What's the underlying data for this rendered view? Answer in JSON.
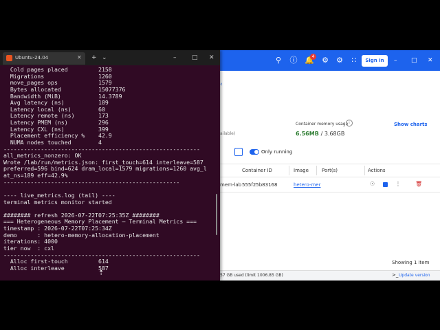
{
  "docker": {
    "sign_in": "Sign in",
    "notification_count": "4",
    "container_memory_usage_label": "Container memory usage",
    "memory_used": "6.56MB",
    "memory_total": "/ 3.68GB",
    "show_charts": "Show charts",
    "available_fragment": "ailable)",
    "only_running_label": "Only running",
    "table": {
      "headers": [
        "Container ID",
        "Image",
        "Port(s)",
        "Actions"
      ],
      "row": {
        "name_fragment": "mem-lab",
        "container_id": "555f25b83168",
        "image": "hetero-mer"
      }
    },
    "showing": "Showing 1 item",
    "footer_used": "57 GB used (limit 1006.85 GB)",
    "update_version": "Update version",
    "colors": {
      "accent": "#1d63ed",
      "memory_value": "#2e7d32"
    },
    "icons": [
      "search-icon",
      "help-icon",
      "bell-icon",
      "extensions-icon",
      "settings-icon",
      "apps-grid-icon",
      "minimize-icon",
      "maximize-icon",
      "close-icon"
    ]
  },
  "terminal": {
    "tab_title": "Ubuntu-24.04",
    "lines": [
      "  Cold pages placed         2158",
      "  Migrations                1260",
      "  move_pages ops            1579",
      "  Bytes allocated           15077376",
      "  Bandwidth (MiB)           14.3789",
      "  Avg latency (ns)          189",
      "  Latency local (ns)        60",
      "  Latency remote (ns)       173",
      "  Latency PMEM (ns)         296",
      "  Latency CXL (ns)          399",
      "  Placement efficiency %    42.9",
      "  NUMA nodes touched        4",
      "----------------------------------------------------------",
      "all_metrics_nonzero: OK",
      "Wrote /lab/run/metrics.json: first_touch=614 interleave=587",
      "preferred=596 bind=624 dram_local=1579 migrations=1260 avg_l",
      "at_ns=189 eff=42.9%",
      "----------------------------------------------------",
      "",
      "---- live_metrics.log (tail) ----",
      "terminal metrics monitor started",
      "",
      "######## refresh 2026-07-22T07:25:35Z ########",
      "=== Heterogeneous Memory Placement — Terminal Metrics ===",
      "timestamp : 2026-07-22T07:25:34Z",
      "demo      : hetero-memory-allocation-placement",
      "iterations: 4000",
      "tier now  : cxl",
      "----------------------------------------------------------",
      "  Alloc first-touch         614",
      "  Alloc interleave          587",
      "",
      ""
    ],
    "colors": {
      "background": "#300a24",
      "text": "#e8e8e8",
      "titlebar": "#1e1e1e"
    }
  }
}
